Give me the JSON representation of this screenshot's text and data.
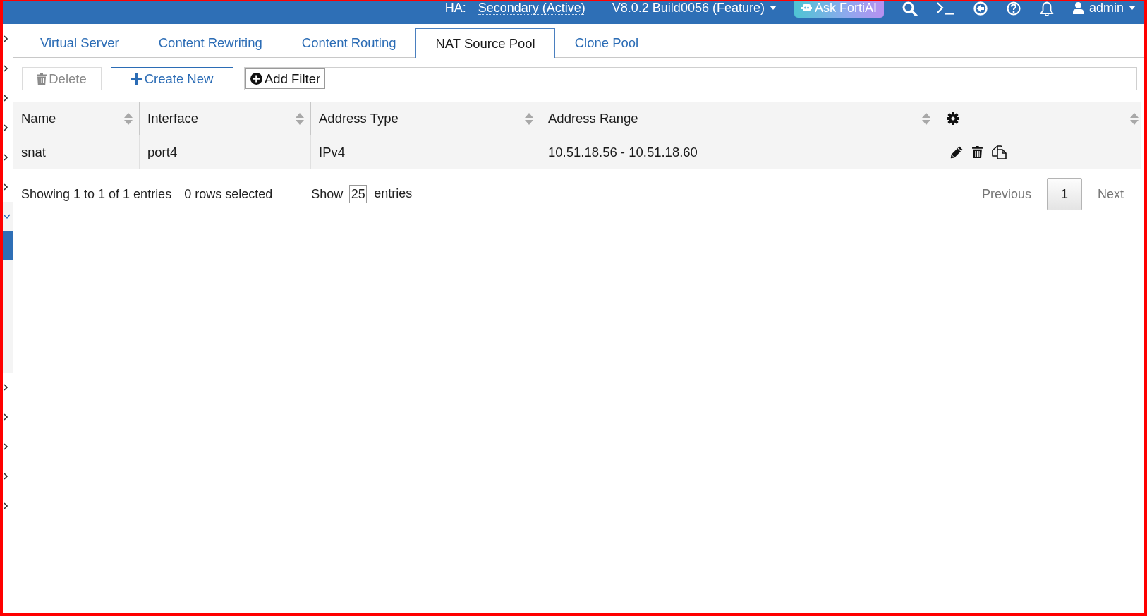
{
  "top_bar": {
    "ha_label": "HA:",
    "ha_status": "Secondary (Active)",
    "version": "V8.0.2 Build0056 (Feature)",
    "ask_button": "Ask FortiAI",
    "user": "admin"
  },
  "sidebar": {
    "items": [
      {
        "expanded": false
      },
      {
        "expanded": false
      },
      {
        "expanded": false
      },
      {
        "expanded": false
      },
      {
        "expanded": false
      },
      {
        "expanded": false
      },
      {
        "expanded": true,
        "children": [
          {
            "selected": true
          },
          {
            "selected": false
          },
          {
            "selected": false
          },
          {
            "selected": false
          },
          {
            "selected": false
          }
        ]
      },
      {
        "expanded": false
      },
      {
        "expanded": false
      },
      {
        "expanded": false
      },
      {
        "expanded": false
      },
      {
        "expanded": false
      }
    ]
  },
  "tabs": [
    {
      "label": "Virtual Server",
      "selected": false
    },
    {
      "label": "Content Rewriting",
      "selected": false
    },
    {
      "label": "Content Routing",
      "selected": false
    },
    {
      "label": "NAT Source Pool",
      "selected": true
    },
    {
      "label": "Clone Pool",
      "selected": false
    }
  ],
  "toolbar": {
    "delete_button": {
      "label": "Delete",
      "disabled": true
    },
    "create_button": "Create New",
    "filter_button": "Add Filter"
  },
  "table": {
    "columns": [
      {
        "kind": "text",
        "label": "Name"
      },
      {
        "kind": "text",
        "label": "Interface"
      },
      {
        "kind": "text",
        "label": "Address Type"
      },
      {
        "kind": "text",
        "label": "Address Range"
      },
      {
        "kind": "settings"
      }
    ],
    "rows": [
      {
        "cells": [
          "snat",
          "port4",
          "IPv4",
          "10.51.18.56 - 10.51.18.60"
        ]
      }
    ]
  },
  "footer": {
    "summary": "Showing 1 to 1 of 1 entries",
    "selection": "0 rows selected",
    "show_label": "Show",
    "page_size": "25",
    "entries_label": "entries",
    "previous": {
      "label": "Previous",
      "disabled": true
    },
    "pages": [
      {
        "label": "1",
        "selected": true
      }
    ],
    "next": {
      "label": "Next",
      "disabled": true
    }
  }
}
